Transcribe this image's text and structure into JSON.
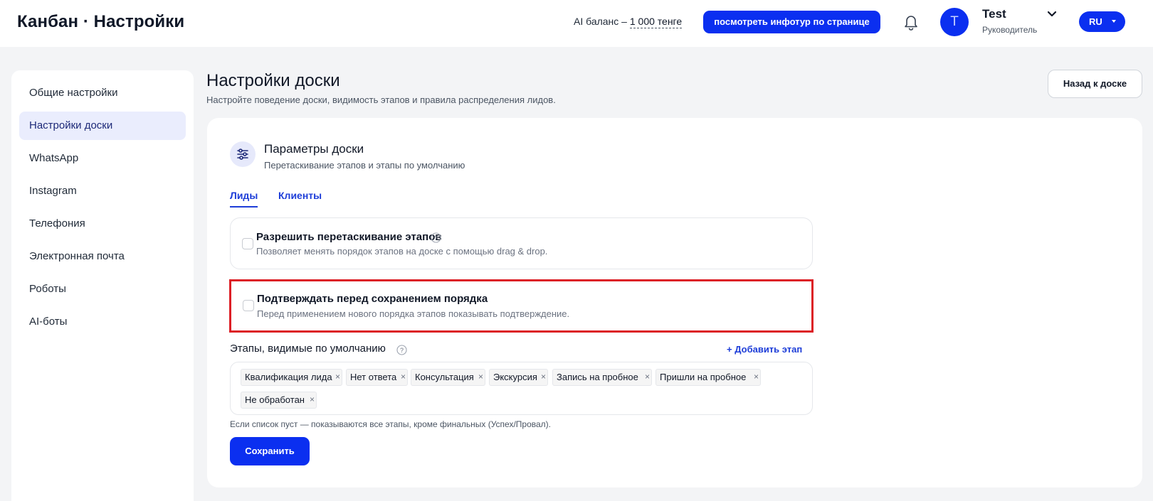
{
  "header": {
    "app_title": "Канбан · Настройки",
    "balance_label": "AI баланс –",
    "balance_amount": "1 000 тенге",
    "infotour_button": "посмотреть инфотур по странице",
    "user": {
      "avatar_letter": "T",
      "name": "Test",
      "role": "Руководитель"
    },
    "language": "RU"
  },
  "sidebar": {
    "items": [
      {
        "label": "Общие настройки",
        "active": false
      },
      {
        "label": "Настройки доски",
        "active": true
      },
      {
        "label": "WhatsApp",
        "active": false
      },
      {
        "label": "Instagram",
        "active": false
      },
      {
        "label": "Телефония",
        "active": false
      },
      {
        "label": "Электронная почта",
        "active": false
      },
      {
        "label": "Роботы",
        "active": false
      },
      {
        "label": "AI-боты",
        "active": false
      }
    ]
  },
  "main": {
    "title": "Настройки доски",
    "subtitle": "Настройте поведение доски, видимость этапов и правила распределения лидов.",
    "back_button": "Назад к доске"
  },
  "card": {
    "title": "Параметры доски",
    "subtitle": "Перетаскивание этапов и этапы по умолчанию",
    "tabs": [
      {
        "label": "Лиды",
        "active": true
      },
      {
        "label": "Клиенты",
        "active": false
      }
    ],
    "options": [
      {
        "title": "Разрешить перетаскивание этапов",
        "description": "Позволяет менять порядок этапов на доске с помощью drag & drop.",
        "checked": false
      },
      {
        "title": "Подтверждать перед сохранением порядка",
        "description": "Перед применением нового порядка этапов показывать подтверждение.",
        "checked": false
      }
    ],
    "stages_label": "Этапы, видимые по умолчанию",
    "add_stage": "+ Добавить этап",
    "stages": [
      "Квалификация лида",
      "Нет ответа",
      "Консультация",
      "Экскурсия",
      "Запись на пробное",
      "Пришли на пробное",
      "Не обработан"
    ],
    "stages_note": "Если список пуст — показываются все этапы, кроме финальных (Успех/Провал).",
    "save_button": "Сохранить"
  },
  "colors": {
    "accent": "#0b2ff0",
    "highlight": "#dc1f26",
    "active_sidebar_bg": "#eaedfd"
  }
}
